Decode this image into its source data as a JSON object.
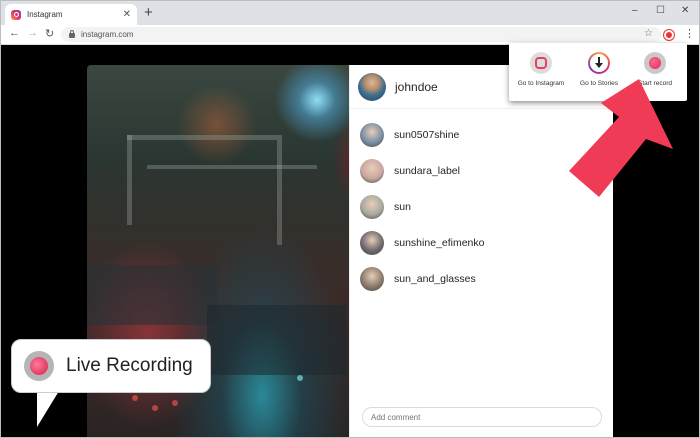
{
  "browser": {
    "tab_title": "Instagram",
    "url": "instagram.com",
    "new_tab_glyph": "+",
    "close_glyph": "✕",
    "window_controls": [
      "–",
      "☐",
      "✕"
    ]
  },
  "instagram": {
    "owner": "johndoe",
    "viewers": [
      {
        "name": "sun0507shine",
        "avatar_color": "#7a8fa3"
      },
      {
        "name": "sundara_label",
        "avatar_color": "#c9a7a2"
      },
      {
        "name": "sun",
        "avatar_color": "#a9a9a0"
      },
      {
        "name": "sunshine_efimenko",
        "avatar_color": "#6d6a6e"
      },
      {
        "name": "sun_and_glasses",
        "avatar_color": "#8a7b6c"
      }
    ],
    "comment_placeholder": "Add comment"
  },
  "extension_popup": {
    "buttons": [
      {
        "label": "Go to Instagram",
        "icon": "instagram-icon"
      },
      {
        "label": "Go to Stories",
        "icon": "download-stories-icon"
      },
      {
        "label": "Start record",
        "icon": "record-icon"
      }
    ]
  },
  "callout": {
    "text": "Live Recording",
    "icon": "record-icon"
  },
  "colors": {
    "accent_red": "#ef3b56",
    "instagram_pink": "#e1306c"
  }
}
